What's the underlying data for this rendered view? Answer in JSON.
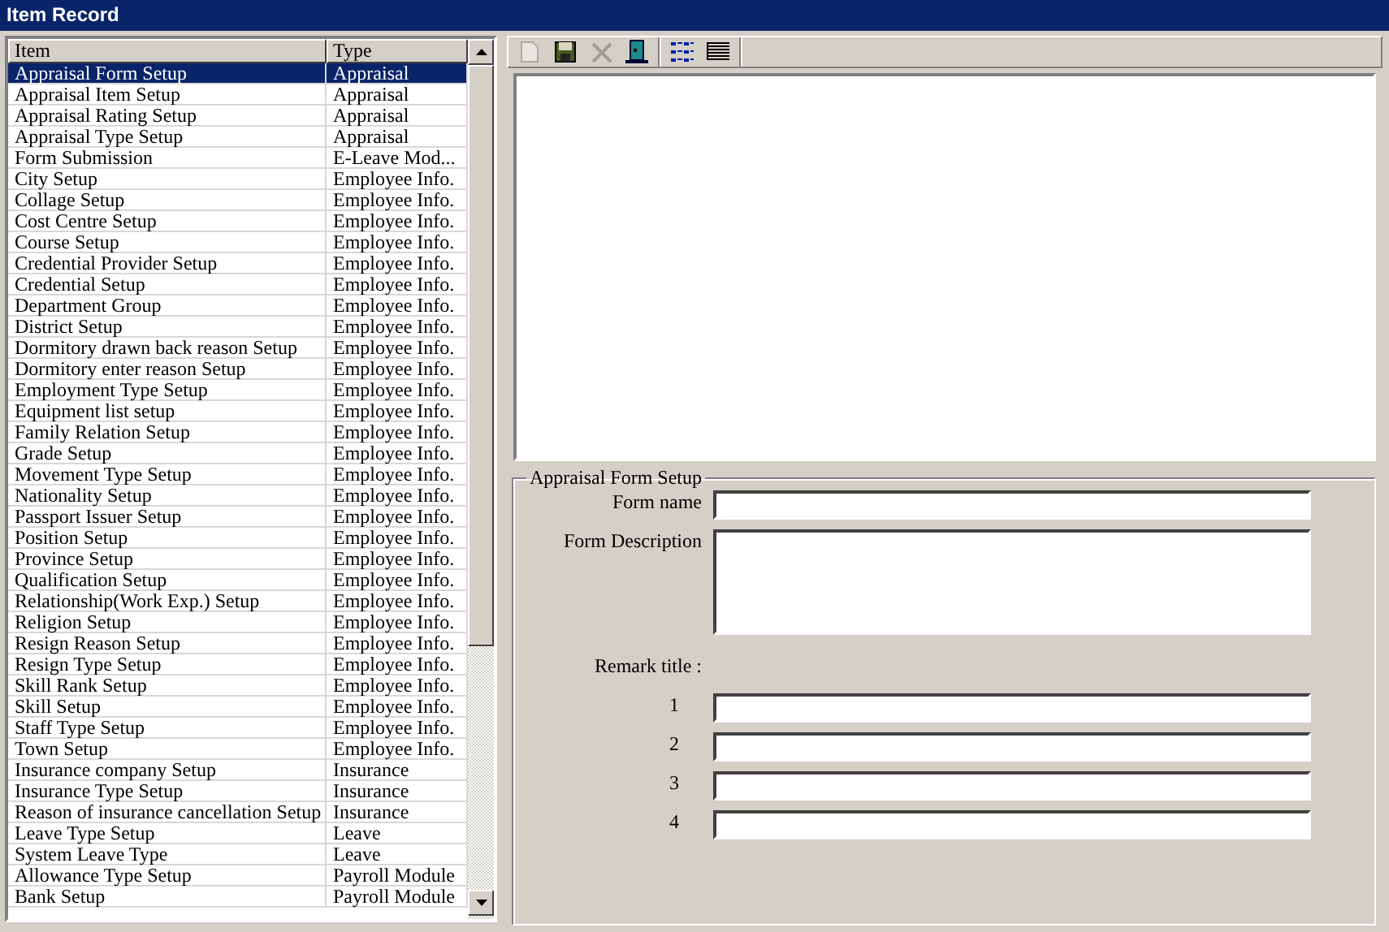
{
  "window": {
    "title": "Item Record"
  },
  "list": {
    "columns": [
      "Item",
      "Type"
    ],
    "rows": [
      {
        "item": "Appraisal Form Setup",
        "type": "Appraisal",
        "selected": true
      },
      {
        "item": "Appraisal Item Setup",
        "type": "Appraisal",
        "selected": false
      },
      {
        "item": "Appraisal Rating Setup",
        "type": "Appraisal",
        "selected": false
      },
      {
        "item": "Appraisal Type Setup",
        "type": "Appraisal",
        "selected": false
      },
      {
        "item": "Form Submission",
        "type": "E-Leave Mod...",
        "selected": false
      },
      {
        "item": "City Setup",
        "type": "Employee Info.",
        "selected": false
      },
      {
        "item": "Collage Setup",
        "type": "Employee Info.",
        "selected": false
      },
      {
        "item": "Cost Centre Setup",
        "type": "Employee Info.",
        "selected": false
      },
      {
        "item": "Course Setup",
        "type": "Employee Info.",
        "selected": false
      },
      {
        "item": "Credential Provider Setup",
        "type": "Employee Info.",
        "selected": false
      },
      {
        "item": "Credential Setup",
        "type": "Employee Info.",
        "selected": false
      },
      {
        "item": "Department Group",
        "type": "Employee Info.",
        "selected": false
      },
      {
        "item": "District Setup",
        "type": "Employee Info.",
        "selected": false
      },
      {
        "item": "Dormitory drawn back reason Setup",
        "type": "Employee Info.",
        "selected": false
      },
      {
        "item": "Dormitory enter reason Setup",
        "type": "Employee Info.",
        "selected": false
      },
      {
        "item": "Employment Type Setup",
        "type": "Employee Info.",
        "selected": false
      },
      {
        "item": "Equipment list setup",
        "type": "Employee Info.",
        "selected": false
      },
      {
        "item": "Family Relation Setup",
        "type": "Employee Info.",
        "selected": false
      },
      {
        "item": "Grade Setup",
        "type": "Employee Info.",
        "selected": false
      },
      {
        "item": "Movement Type Setup",
        "type": "Employee Info.",
        "selected": false
      },
      {
        "item": "Nationality Setup",
        "type": "Employee Info.",
        "selected": false
      },
      {
        "item": "Passport Issuer Setup",
        "type": "Employee Info.",
        "selected": false
      },
      {
        "item": "Position Setup",
        "type": "Employee Info.",
        "selected": false
      },
      {
        "item": "Province Setup",
        "type": "Employee Info.",
        "selected": false
      },
      {
        "item": "Qualification Setup",
        "type": "Employee Info.",
        "selected": false
      },
      {
        "item": "Relationship(Work Exp.) Setup",
        "type": "Employee Info.",
        "selected": false
      },
      {
        "item": "Religion Setup",
        "type": "Employee Info.",
        "selected": false
      },
      {
        "item": "Resign Reason Setup",
        "type": "Employee Info.",
        "selected": false
      },
      {
        "item": "Resign Type Setup",
        "type": "Employee Info.",
        "selected": false
      },
      {
        "item": "Skill Rank Setup",
        "type": "Employee Info.",
        "selected": false
      },
      {
        "item": "Skill Setup",
        "type": "Employee Info.",
        "selected": false
      },
      {
        "item": "Staff Type Setup",
        "type": "Employee Info.",
        "selected": false
      },
      {
        "item": "Town Setup",
        "type": "Employee Info.",
        "selected": false
      },
      {
        "item": "Insurance company Setup",
        "type": "Insurance",
        "selected": false
      },
      {
        "item": "Insurance Type Setup",
        "type": "Insurance",
        "selected": false
      },
      {
        "item": "Reason of insurance cancellation Setup",
        "type": "Insurance",
        "selected": false
      },
      {
        "item": "Leave Type Setup",
        "type": "Leave",
        "selected": false
      },
      {
        "item": "System Leave Type",
        "type": "Leave",
        "selected": false
      },
      {
        "item": "Allowance Type Setup",
        "type": "Payroll Module",
        "selected": false
      },
      {
        "item": "Bank Setup",
        "type": "Payroll Module",
        "selected": false
      }
    ]
  },
  "toolbar": [
    {
      "kind": "new",
      "disabled": true
    },
    {
      "kind": "save",
      "disabled": false
    },
    {
      "kind": "delete",
      "disabled": true
    },
    {
      "kind": "exit",
      "disabled": false
    },
    {
      "kind": "list-view",
      "disabled": false
    },
    {
      "kind": "grid-view",
      "disabled": false
    }
  ],
  "form": {
    "title": "Appraisal Form Setup",
    "fields": [
      {
        "label": "Form name",
        "kind": "line"
      },
      {
        "label": "Form Description",
        "kind": "area"
      }
    ],
    "remark_title": "Remark title :",
    "remarks": [
      {
        "label": "1"
      },
      {
        "label": "2"
      },
      {
        "label": "3"
      },
      {
        "label": "4"
      }
    ]
  }
}
